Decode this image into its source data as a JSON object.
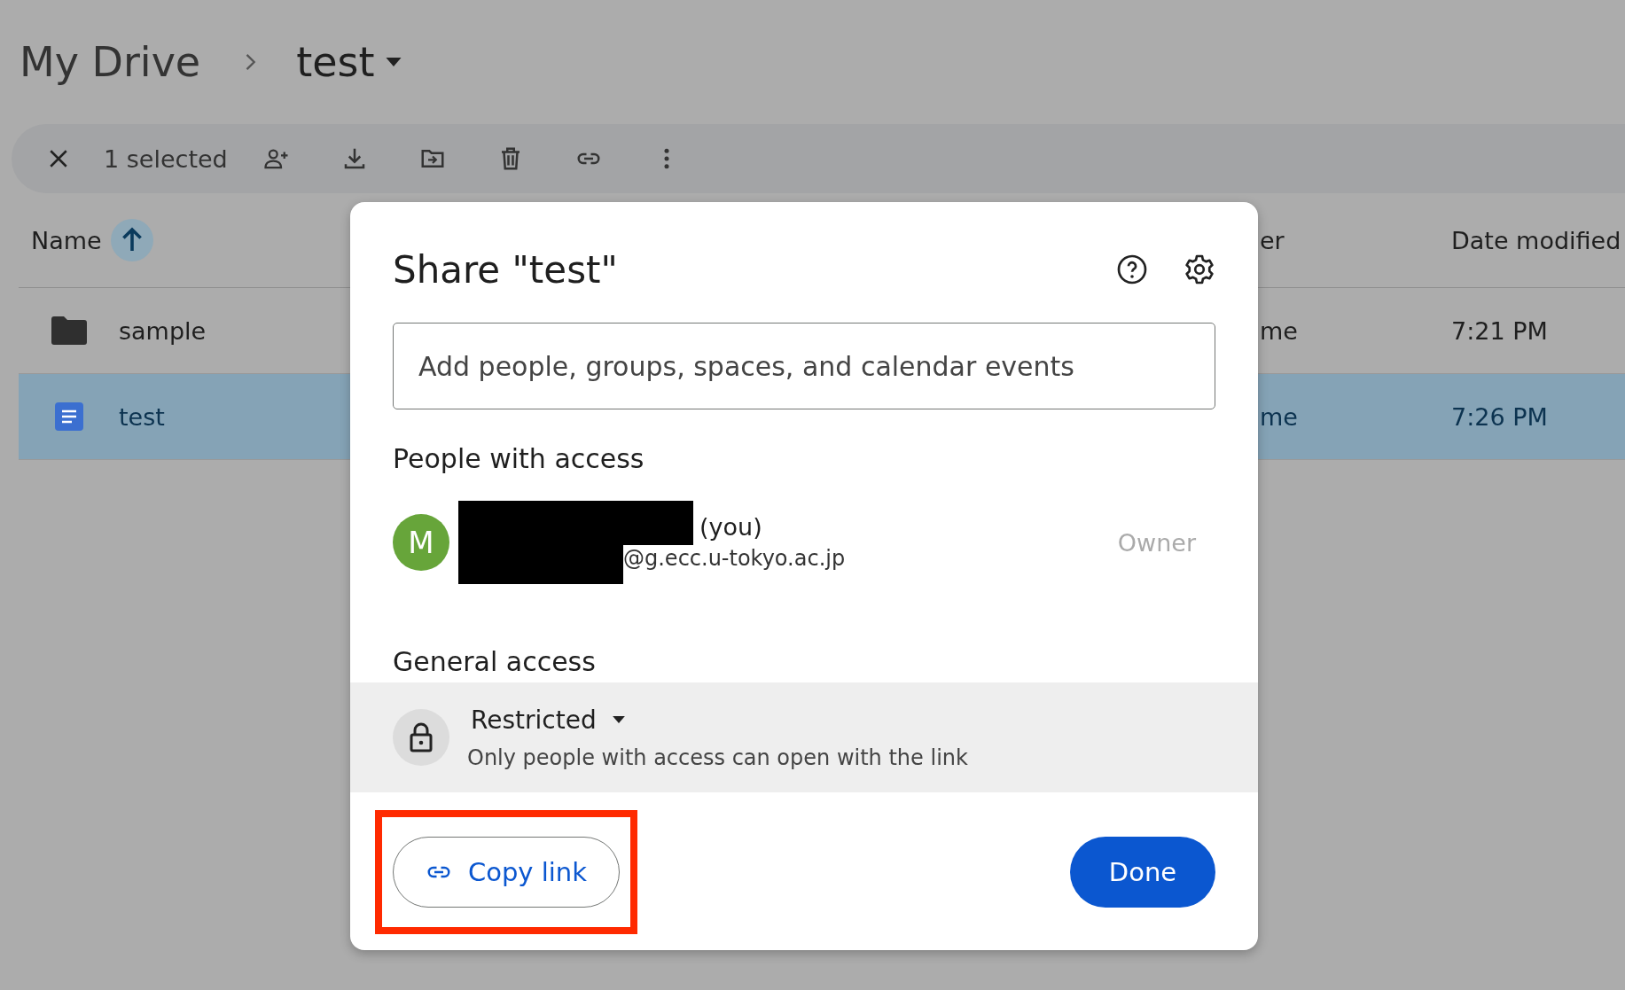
{
  "breadcrumb": {
    "parent": "My Drive",
    "current": "test"
  },
  "toolbar": {
    "selection": "1 selected"
  },
  "table": {
    "columns": [
      "Name",
      "er",
      "Date modified"
    ],
    "rows": [
      {
        "kind": "folder",
        "name": "sample",
        "column_2": "me",
        "date": "7:21 PM",
        "selected": false
      },
      {
        "kind": "document",
        "name": "test",
        "column_2": "me",
        "date": "7:26 PM",
        "selected": true
      }
    ]
  },
  "dialog": {
    "title": "Share \"test\"",
    "search": {
      "placeholder": "Add people, groups, spaces, and calendar events"
    },
    "people_heading": "People with access",
    "people": [
      {
        "initial": "M",
        "name_suffix": "(you)",
        "email": "@g.ecc.u-tokyo.ac.jp",
        "role": "Owner",
        "color": "#67a53a"
      }
    ],
    "general_heading": "General access",
    "access": {
      "level": "Restricted",
      "description": "Only people with access can open with the link"
    },
    "copy_button": "Copy link",
    "done_button": "Done"
  }
}
